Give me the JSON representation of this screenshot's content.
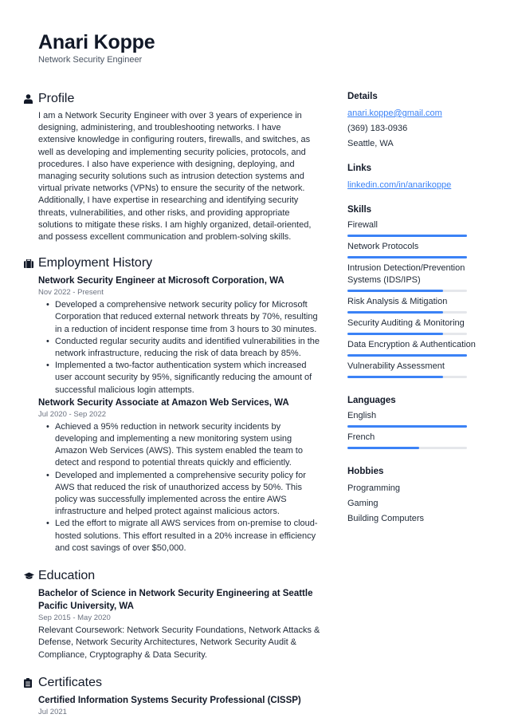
{
  "header": {
    "name": "Anari Koppe",
    "title": "Network Security Engineer"
  },
  "profile": {
    "title": "Profile",
    "icon": "user-icon",
    "text": "I am a Network Security Engineer with over 3 years of experience in designing, administering, and troubleshooting networks. I have extensive knowledge in configuring routers, firewalls, and switches, as well as developing and implementing security policies, protocols, and procedures. I also have experience with designing, deploying, and managing security solutions such as intrusion detection systems and virtual private networks (VPNs) to ensure the security of the network. Additionally, I have expertise in researching and identifying security threats, vulnerabilities, and other risks, and providing appropriate solutions to mitigate these risks. I am highly organized, detail-oriented, and possess excellent communication and problem-solving skills."
  },
  "employment": {
    "title": "Employment History",
    "icon": "briefcase-icon",
    "jobs": [
      {
        "title": "Network Security Engineer at Microsoft Corporation, WA",
        "date": "Nov 2022 - Present",
        "bullets": [
          "Developed a comprehensive network security policy for Microsoft Corporation that reduced external network threats by 70%, resulting in a reduction of incident response time from 3 hours to 30 minutes.",
          "Conducted regular security audits and identified vulnerabilities in the network infrastructure, reducing the risk of data breach by 85%.",
          "Implemented a two-factor authentication system which increased user account security by 95%, significantly reducing the amount of successful malicious login attempts."
        ]
      },
      {
        "title": "Network Security Associate at Amazon Web Services, WA",
        "date": "Jul 2020 - Sep 2022",
        "bullets": [
          "Achieved a 95% reduction in network security incidents by developing and implementing a new monitoring system using Amazon Web Services (AWS). This system enabled the team to detect and respond to potential threats quickly and efficiently.",
          "Developed and implemented a comprehensive security policy for AWS that reduced the risk of unauthorized access by 50%. This policy was successfully implemented across the entire AWS infrastructure and helped protect against malicious actors.",
          "Led the effort to migrate all AWS services from on-premise to cloud-hosted solutions. This effort resulted in a 20% increase in efficiency and cost savings of over $50,000."
        ]
      }
    ]
  },
  "education": {
    "title": "Education",
    "icon": "graduation-cap-icon",
    "items": [
      {
        "title": "Bachelor of Science in Network Security Engineering at Seattle Pacific University, WA",
        "date": "Sep 2015 - May 2020",
        "text": "Relevant Coursework: Network Security Foundations, Network Attacks & Defense, Network Security Architectures, Network Security Audit & Compliance, Cryptography & Data Security."
      }
    ]
  },
  "certificates": {
    "title": "Certificates",
    "icon": "clipboard-icon",
    "items": [
      {
        "title": "Certified Information Systems Security Professional (CISSP)",
        "date": "Jul 2021"
      }
    ]
  },
  "details": {
    "title": "Details",
    "email": "anari.koppe@gmail.com",
    "phone": "(369) 183-0936",
    "location": "Seattle, WA"
  },
  "links": {
    "title": "Links",
    "items": [
      "linkedin.com/in/anarikoppe"
    ]
  },
  "skills": {
    "title": "Skills",
    "items": [
      {
        "label": "Firewall",
        "level": 100
      },
      {
        "label": "Network Protocols",
        "level": 100
      },
      {
        "label": "Intrusion Detection/Prevention Systems (IDS/IPS)",
        "level": 80
      },
      {
        "label": "Risk Analysis & Mitigation",
        "level": 80
      },
      {
        "label": "Security Auditing & Monitoring",
        "level": 80
      },
      {
        "label": "Data Encryption & Authentication",
        "level": 100
      },
      {
        "label": "Vulnerability Assessment",
        "level": 80
      }
    ]
  },
  "languages": {
    "title": "Languages",
    "items": [
      {
        "label": "English",
        "level": 100
      },
      {
        "label": "French",
        "level": 60
      }
    ]
  },
  "hobbies": {
    "title": "Hobbies",
    "items": [
      "Programming",
      "Gaming",
      "Building Computers"
    ]
  },
  "colors": {
    "accent": "#3b82f6",
    "track": "#e5e7eb",
    "text": "#1f2937",
    "muted": "#6b7280"
  }
}
